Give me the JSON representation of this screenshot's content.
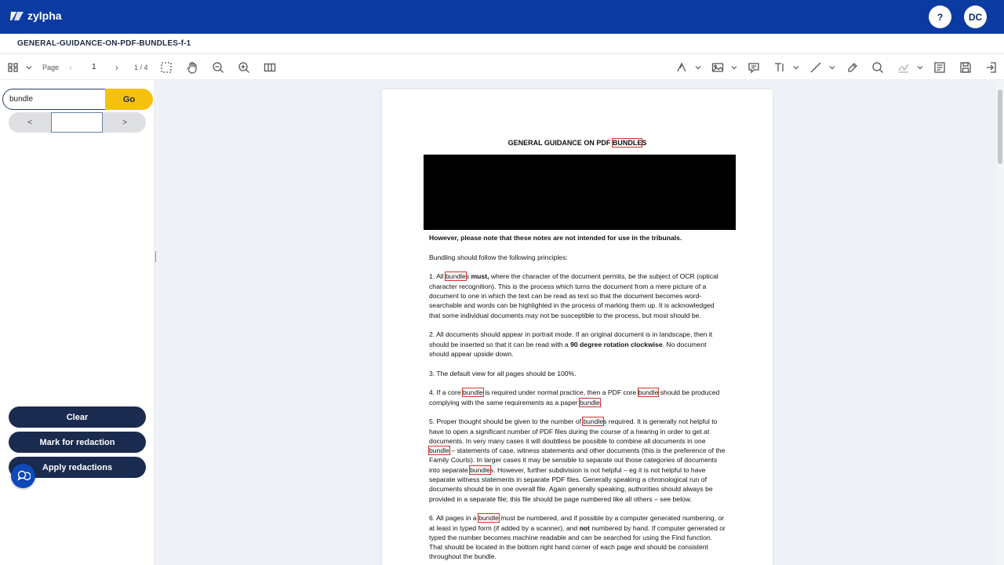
{
  "app": {
    "name": "zylpha",
    "help_label": "?",
    "avatar_initials": "DC"
  },
  "file": {
    "name": "GENERAL-GUIDANCE-ON-PDF-BUNDLES-f-1"
  },
  "toolbar": {
    "page_label": "Page",
    "page_value": "1",
    "page_total": "1 / 4",
    "prev_page": "‹",
    "next_page": "›"
  },
  "search": {
    "value": "bundle",
    "go_label": "Go",
    "prev_label": "<",
    "next_label": ">"
  },
  "actions": {
    "clear_label": "Clear",
    "mark_label": "Mark for redaction",
    "apply_label": "Apply redactions"
  },
  "document": {
    "title_prefix": "GENERAL GUIDANCE ON PDF ",
    "title_hl": "BUNDLE",
    "title_suffix": "S",
    "notice": "However, please note that these notes are not intended for use in the tribunals.",
    "intro": "Bundling should follow the following principles:",
    "p1": {
      "a": "1.  All ",
      "hl": "bundle",
      "b": "s ",
      "bold": "must,",
      "c": " where the character of the document permits, be the subject of OCR (optical character recognition).  This is the process which turns the document from a mere picture of a document to one in which the text can be read as text so that the document becomes word-searchable and words can be highlighted in the process of marking them up.  It is acknowledged that some individual documents may not be susceptible to the process, but most should be."
    },
    "p2": {
      "a": "2.  All documents should appear in portrait mode.  If an original document is in landscape, then it should be inserted so that it can be read with a ",
      "bold": "90 degree rotation clockwise",
      "b": ".  No document should appear upside down."
    },
    "p3": "3.  The default view for all pages should be 100%.",
    "p4": {
      "a": "4.  If a core ",
      "hl1": "bundle",
      "b": " is required under normal practice, then a PDF core ",
      "hl2": "bundle",
      "c": " should be produced complying with the same requirements as a paper ",
      "hl3": "bundle",
      "d": "."
    },
    "p5": {
      "a": "5.  Proper thought should be given to the number of ",
      "hl1": "bundle",
      "b": "s required.  It is generally not helpful to have to open a significant number of PDF files during the course of a hearing in order to get at documents.  In very many cases it will doubtless be possible to combine all documents in one ",
      "hl2": "bundle",
      "c": " – statements of case, witness statements and other documents (this is the preference of the Family Courts).  In larger cases it may be sensible to separate out those categories of documents into separate ",
      "hl3": "bundle",
      "d": "s.  However, further subdivision is not helpful – eg it is not helpful to have separate witness statements in separate PDF files.  Generally speaking a chronological run of documents should be in one overall file.  Again generally speaking, authorities should always be provided in a separate file; this file should be page numbered like all others – see below."
    },
    "p6": {
      "a": "6.  All pages in a ",
      "hl": "bundle",
      "b": " must be numbered, and if possible by a computer generated numbering, or at least in typed form (if added by a scanner), and ",
      "bold": "not",
      "c": " numbered by hand.  If computer generated or typed the number becomes machine readable and can be searched for using the Find function. That should be located in the bottom right hand corner of each page and should be consistent throughout the bundle."
    }
  },
  "colors": {
    "brand": "#0b3aa3",
    "accent": "#f6c10c",
    "dark_button": "#1b2b4f",
    "highlight": "#d0342c"
  }
}
